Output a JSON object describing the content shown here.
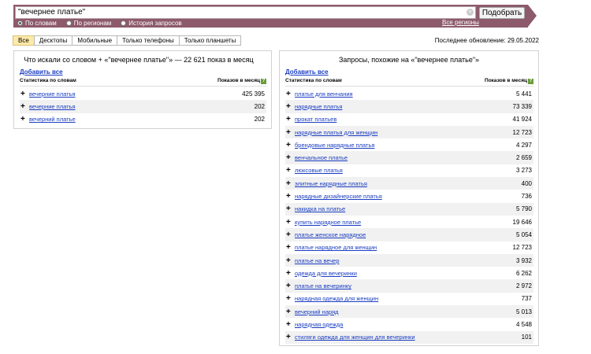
{
  "search": {
    "query": "\"вечернее платье\"",
    "button_label": "Подобрать",
    "clear_glyph": "×"
  },
  "modes": [
    {
      "label": "По словам",
      "selected": true
    },
    {
      "label": "По регионам",
      "selected": false
    },
    {
      "label": "История запросов",
      "selected": false
    }
  ],
  "all_regions_label": "Все регионы",
  "tabs": [
    "Все",
    "Десктопы",
    "Мобильные",
    "Только телефоны",
    "Только планшеты"
  ],
  "active_tab": "Все",
  "last_update": "Последнее обновление: 29.05.2022",
  "left": {
    "title": "Что искали со словом  +  «\"вечернее платье\"» — 22 621 показ в месяц",
    "add_all": "Добавить все",
    "col_words": "Статистика по словам",
    "col_count": "Показов в месяц",
    "rows": [
      {
        "phrase": "вечерние платья",
        "count": "425 395"
      },
      {
        "phrase": "вечерние платья",
        "count": "202"
      },
      {
        "phrase": "вечерний платье",
        "count": "202"
      }
    ]
  },
  "right": {
    "title": "Запросы, похожие на «\"вечернее платье\"»",
    "add_all": "Добавить все",
    "col_words": "Статистика по словам",
    "col_count": "Показов в месяц",
    "rows": [
      {
        "phrase": "платье для венчания",
        "count": "5 441"
      },
      {
        "phrase": "нарядные платья",
        "count": "73 339"
      },
      {
        "phrase": "прокат платьев",
        "count": "41 924"
      },
      {
        "phrase": "нарядные платья для женщин",
        "count": "12 723"
      },
      {
        "phrase": "брендовые нарядные платья",
        "count": "4 297"
      },
      {
        "phrase": "венчальное платье",
        "count": "2 659"
      },
      {
        "phrase": "люксовые платья",
        "count": "3 273"
      },
      {
        "phrase": "элитные нарядные платья",
        "count": "400"
      },
      {
        "phrase": "нарядные дизайнерские платья",
        "count": "736"
      },
      {
        "phrase": "накидка на платье",
        "count": "5 790"
      },
      {
        "phrase": "купить нарядное платье",
        "count": "19 646"
      },
      {
        "phrase": "платье женское нарядное",
        "count": "5 054"
      },
      {
        "phrase": "платье нарядное для женщин",
        "count": "12 723"
      },
      {
        "phrase": "платье на вечер",
        "count": "3 932"
      },
      {
        "phrase": "одежда для вечеринки",
        "count": "6 262"
      },
      {
        "phrase": "платье на вечеринку",
        "count": "2 972"
      },
      {
        "phrase": "нарядная одежда для женщин",
        "count": "737"
      },
      {
        "phrase": "вечерний наряд",
        "count": "5 013"
      },
      {
        "phrase": "нарядная одежда",
        "count": "4 548"
      },
      {
        "phrase": "стиляги одежда для женщин для вечеринки",
        "count": "101"
      }
    ]
  },
  "colors": {
    "band": "#8c5a6b",
    "link": "#1a3dc1",
    "active_tab": "#fde9a8",
    "help_badge": "#6b9c3b"
  },
  "icons": {
    "plus": "+",
    "help": "?"
  }
}
